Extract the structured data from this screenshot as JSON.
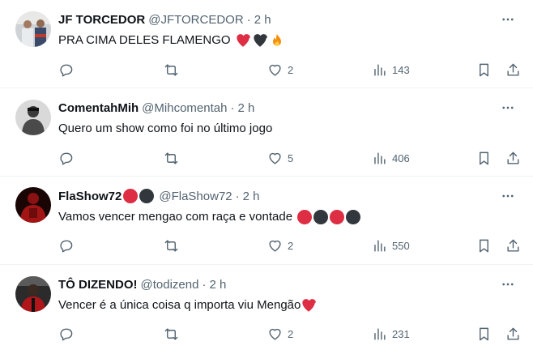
{
  "tweets": [
    {
      "name": "JF TORCEDOR",
      "handle": "@JFTORCEDOR",
      "separator": "·",
      "time": "2 h",
      "text": "PRA CIMA DELES FLAMENGO",
      "emojis": [
        "red-heart",
        "black-heart",
        "fire"
      ],
      "replies": "",
      "retweets": "",
      "likes": "2",
      "views": "143"
    },
    {
      "name": "ComentahMih",
      "handle": "@Mihcomentah",
      "separator": "·",
      "time": "2 h",
      "text": "Quero um show como foi no último jogo",
      "emojis": [],
      "replies": "",
      "retweets": "",
      "likes": "5",
      "views": "406"
    },
    {
      "name": "FlaShow72",
      "name_badges": [
        "red-circle",
        "black-circle"
      ],
      "handle": "@FlaShow72",
      "separator": "·",
      "time": "2 h",
      "text": "Vamos vencer mengao com raça e vontade",
      "emojis": [
        "red-circle",
        "black-circle",
        "red-circle",
        "black-circle"
      ],
      "replies": "",
      "retweets": "",
      "likes": "2",
      "views": "550"
    },
    {
      "name": "TÔ DIZENDO!",
      "handle": "@todizend",
      "separator": "·",
      "time": "2 h",
      "text": "Vencer é a única coisa q importa viu Mengão",
      "emojis": [
        "red-heart"
      ],
      "replies": "",
      "retweets": "",
      "likes": "2",
      "views": "231"
    }
  ],
  "colors": {
    "text": "#0f1419",
    "muted": "#536471",
    "divider": "#eff3f4",
    "flamengo_red": "#dd2e44",
    "flamengo_black": "#31373d"
  },
  "icons": [
    "reply-icon",
    "retweet-icon",
    "like-icon",
    "views-icon",
    "bookmark-icon",
    "share-icon",
    "more-icon"
  ]
}
